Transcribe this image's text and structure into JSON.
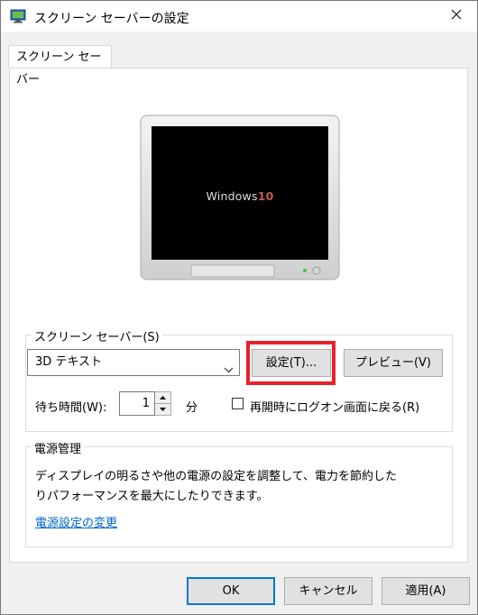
{
  "window": {
    "title": "スクリーン セーバーの設定"
  },
  "tab": {
    "label": "スクリーン セーバー"
  },
  "preview": {
    "text_main": "Windows",
    "text_version": "10"
  },
  "screensaver_group": {
    "legend": "スクリーン セーバー(S)",
    "selected": "3D テキスト",
    "settings_button": "設定(T)...",
    "preview_button": "プレビュー(V)",
    "wait_label": "待ち時間(W):",
    "wait_value": "1",
    "wait_unit": "分",
    "resume_checkbox_label": "再開時にログオン画面に戻る(R)",
    "resume_checked": false
  },
  "power_group": {
    "legend": "電源管理",
    "description_line1": "ディスプレイの明るさや他の電源の設定を調整して、電力を節約した",
    "description_line2": "りパフォーマンスを最大にしたりできます。",
    "link": "電源設定の変更"
  },
  "footer": {
    "ok": "OK",
    "cancel": "キャンセル",
    "apply": "適用(A)"
  },
  "colors": {
    "highlight": "#e8212b",
    "link": "#0066cc",
    "ok_border": "#0078d7"
  }
}
